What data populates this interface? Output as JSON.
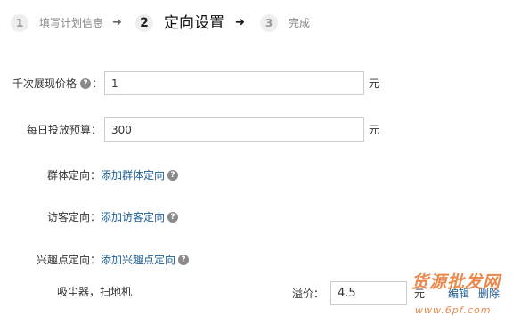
{
  "steps": [
    {
      "number": "1",
      "label": "填写计划信息"
    },
    {
      "number": "2",
      "label": "定向设置"
    },
    {
      "number": "3",
      "label": "完成"
    }
  ],
  "step_arrow": "➜",
  "form": {
    "cpm_price": {
      "label": "千次展现价格",
      "colon": "：",
      "value": "1",
      "unit": "元"
    },
    "daily_budget": {
      "label": "每日投放预算：",
      "value": "300",
      "unit": "元"
    },
    "group_targeting": {
      "label": "群体定向：",
      "link": "添加群体定向"
    },
    "visitor_targeting": {
      "label": "访客定向：",
      "link": "添加访客定向"
    },
    "interest_targeting": {
      "label": "兴趣点定向：",
      "link": "添加兴趣点定向"
    }
  },
  "interest_row": {
    "keywords": "吸尘器，扫地机",
    "premium_label": "溢价：",
    "premium_value": "4.5",
    "premium_unit": "元",
    "edit_link": "编辑",
    "delete_link": "删除"
  },
  "help_glyph": "?",
  "watermark": {
    "line1": "货源批发网",
    "line2": "www.6pf.com"
  },
  "colors": {
    "link": "#1f5d91",
    "watermark": "#e8742c",
    "help_icon": "#8a8a8a"
  }
}
